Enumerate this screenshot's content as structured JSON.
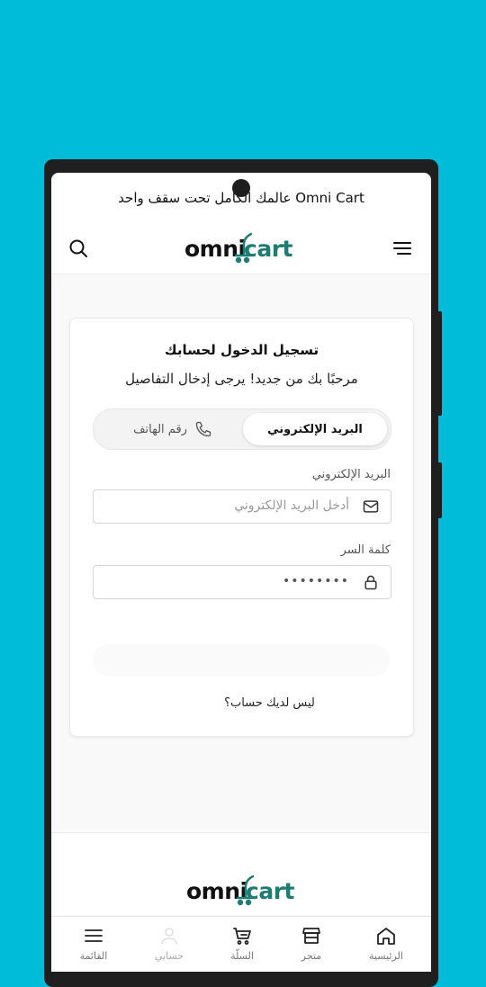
{
  "announcement": {
    "text": "Omni Cart عالمك الكامل تحت سقف واحد"
  },
  "header": {
    "logo": {
      "part1": "omni",
      "part2": "cart"
    },
    "menu_icon": "hamburger-icon",
    "search_icon": "search-icon"
  },
  "login": {
    "title": "تسجيل الدخول لحسابك",
    "subtitle": "مرحبًا بك من جديد! يرجى إدخال التفاصيل",
    "tabs": {
      "email": "البريد الإلكتروني",
      "phone": "رقم الهاتف",
      "selected": "email"
    },
    "email_label": "البريد الإلكتروني",
    "email_placeholder": "أدخل البريد الإلكتروني",
    "password_label": "كلمة السر",
    "password_value": "••••••••",
    "no_account": "ليس لديك حساب؟"
  },
  "footer": {
    "logo": {
      "part1": "omni",
      "part2": "cart"
    }
  },
  "bottom_nav": [
    {
      "label": "الرئيسية",
      "icon": "home-icon"
    },
    {
      "label": "متجر",
      "icon": "store-icon"
    },
    {
      "label": "السلّة",
      "icon": "cart-icon"
    },
    {
      "label": "حسابي",
      "icon": "user-icon"
    },
    {
      "label": "القائمة",
      "icon": "menu-icon"
    }
  ],
  "colors": {
    "background": "#00BCD8",
    "brand_green": "#1e7d73",
    "phone_frame": "#1f1f1f"
  }
}
